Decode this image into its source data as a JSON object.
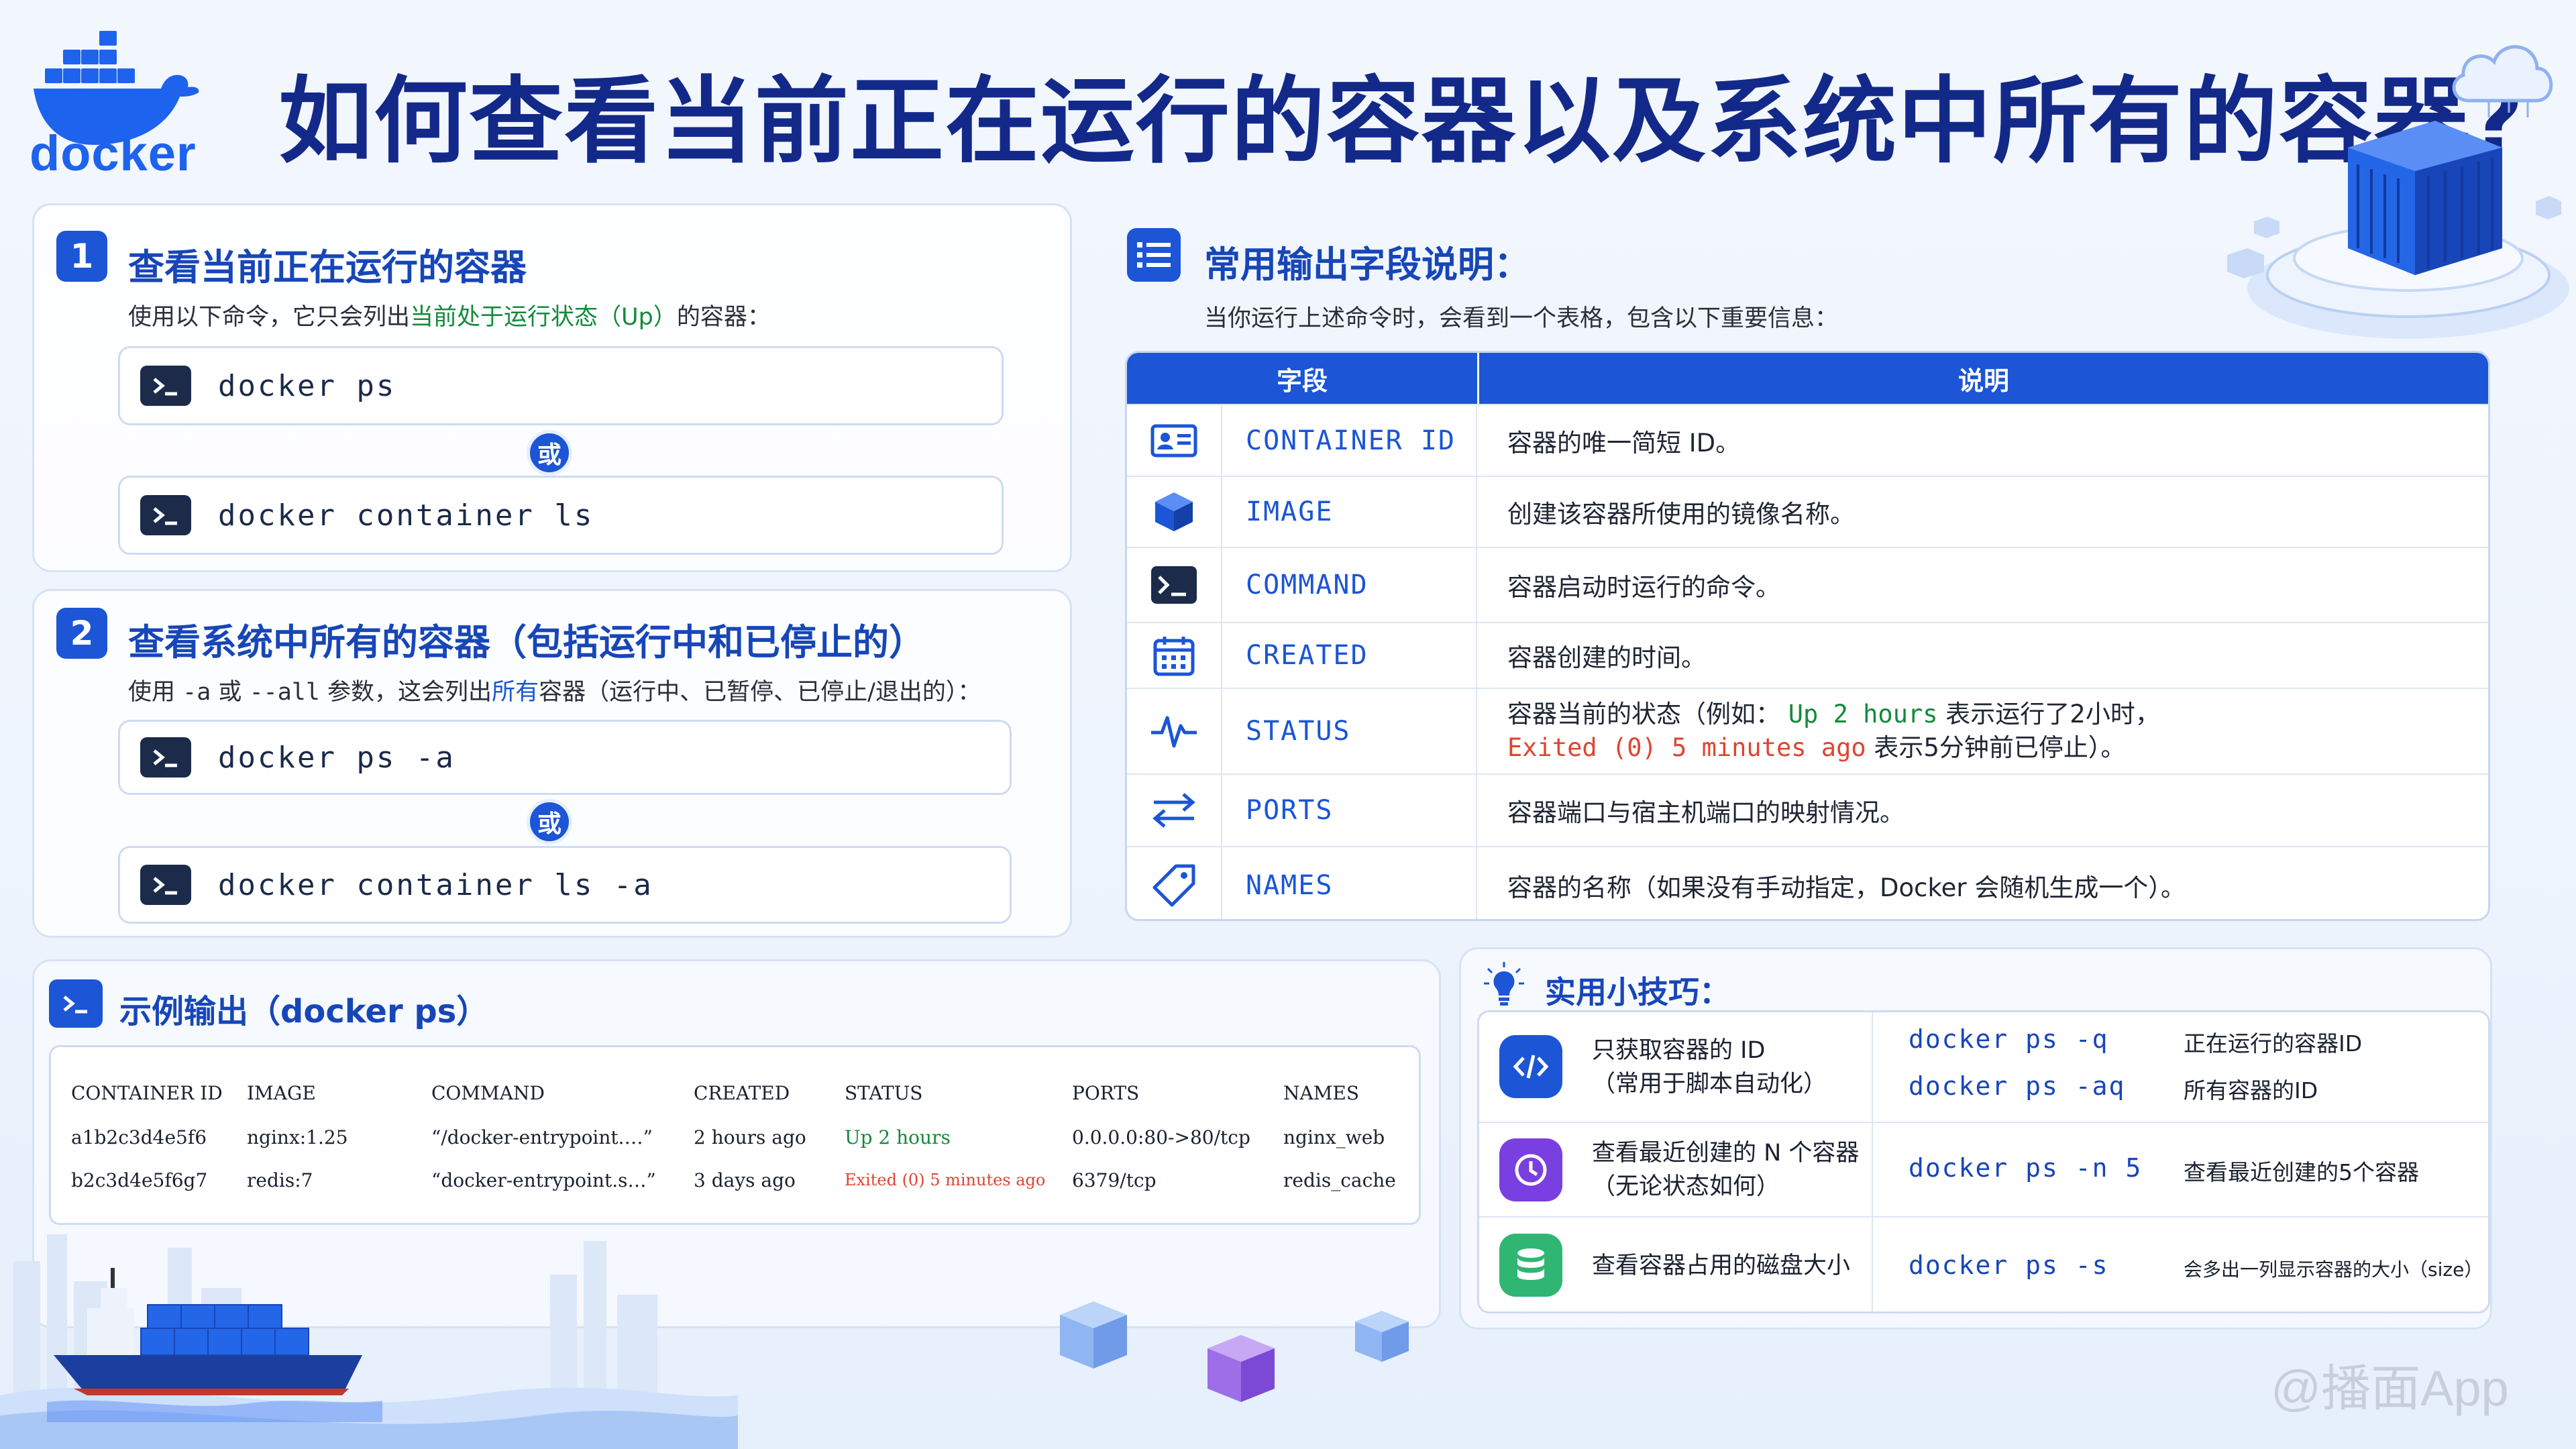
{
  "header": {
    "logo_text": "docker",
    "title": "如何查看当前正在运行的容器以及系统中所有的容器?"
  },
  "section1": {
    "number": "1",
    "title": "查看当前正在运行的容器",
    "desc_pre": "使用以下命令，它只会列出",
    "desc_highlight": "当前处于运行状态（Up）",
    "desc_post": "的容器：",
    "cmd1": "docker ps",
    "or_label": "或",
    "cmd2": "docker container ls"
  },
  "section2": {
    "number": "2",
    "title": "查看系统中所有的容器（包括运行中和已停止的）",
    "desc_pre": "使用 ",
    "desc_flag1": "-a",
    "desc_mid1": " 或 ",
    "desc_flag2": "--all",
    "desc_mid2": " 参数，这会列出",
    "desc_highlight": "所有",
    "desc_post": "容器（运行中、已暂停、已停止/退出的）：",
    "cmd1": "docker ps -a",
    "or_label": "或",
    "cmd2": "docker container ls -a"
  },
  "fields": {
    "title": "常用输出字段说明：",
    "desc": "当你运行上述命令时，会看到一个表格，包含以下重要信息：",
    "col_field": "字段",
    "col_desc": "说明",
    "rows": [
      {
        "icon": "id-card-icon",
        "field": "CONTAINER ID",
        "desc": "容器的唯一简短 ID。"
      },
      {
        "icon": "cube-icon",
        "field": "IMAGE",
        "desc": "创建该容器所使用的镜像名称。"
      },
      {
        "icon": "terminal-icon",
        "field": "COMMAND",
        "desc": "容器启动时运行的命令。"
      },
      {
        "icon": "calendar-icon",
        "field": "CREATED",
        "desc": "容器创建的时间。"
      },
      {
        "icon": "pulse-icon",
        "field": "STATUS",
        "desc_pre": "容器当前的状态（例如：",
        "desc_up": "Up 2 hours",
        "desc_mid": "表示运行了2小时，",
        "desc_exited": "Exited (0) 5 minutes ago",
        "desc_post": "表示5分钟前已停止）。"
      },
      {
        "icon": "arrows-icon",
        "field": "PORTS",
        "desc": "容器端口与宿主机端口的映射情况。"
      },
      {
        "icon": "tag-icon",
        "field": "NAMES",
        "desc": "容器的名称（如果没有手动指定，Docker 会随机生成一个）。"
      }
    ]
  },
  "example": {
    "title": "示例输出（docker ps）",
    "headers": [
      "CONTAINER ID",
      "IMAGE",
      "COMMAND",
      "CREATED",
      "STATUS",
      "PORTS",
      "NAMES"
    ],
    "rows": [
      [
        "a1b2c3d4e5f6",
        "nginx:1.25",
        "“/docker-entrypoint.…”",
        "2 hours ago",
        "Up 2 hours",
        "0.0.0.0:80->80/tcp",
        "nginx_web"
      ],
      [
        "b2c3d4e5f6g7",
        "redis:7",
        "“docker-entrypoint.s…”",
        "3 days ago",
        "Exited (0) 5 minutes ago",
        "6379/tcp",
        "redis_cache"
      ]
    ]
  },
  "tips": {
    "title": "实用小技巧：",
    "rows": [
      {
        "icon": "code-icon",
        "text": [
          "只获取容器的 ID",
          "（常用于脚本自动化）"
        ],
        "cmds": [
          {
            "cmd": "docker ps -q",
            "note": "正在运行的容器ID"
          },
          {
            "cmd": "docker ps -aq",
            "note": "所有容器的ID"
          }
        ]
      },
      {
        "icon": "clock-icon",
        "text": [
          "查看最近创建的 N 个容器",
          "（无论状态如何）"
        ],
        "cmds": [
          {
            "cmd": "docker ps -n 5",
            "note": "查看最近创建的5个容器"
          }
        ]
      },
      {
        "icon": "database-icon",
        "text": [
          "查看容器占用的磁盘大小"
        ],
        "cmds": [
          {
            "cmd": "docker ps -s",
            "note": "会多出一列显示容器的大小（size）"
          }
        ]
      }
    ]
  },
  "watermark": "@播面App",
  "colors": {
    "primary": "#1c55d6",
    "title": "#13298a",
    "green": "#148a3b",
    "red": "#e0442f"
  }
}
